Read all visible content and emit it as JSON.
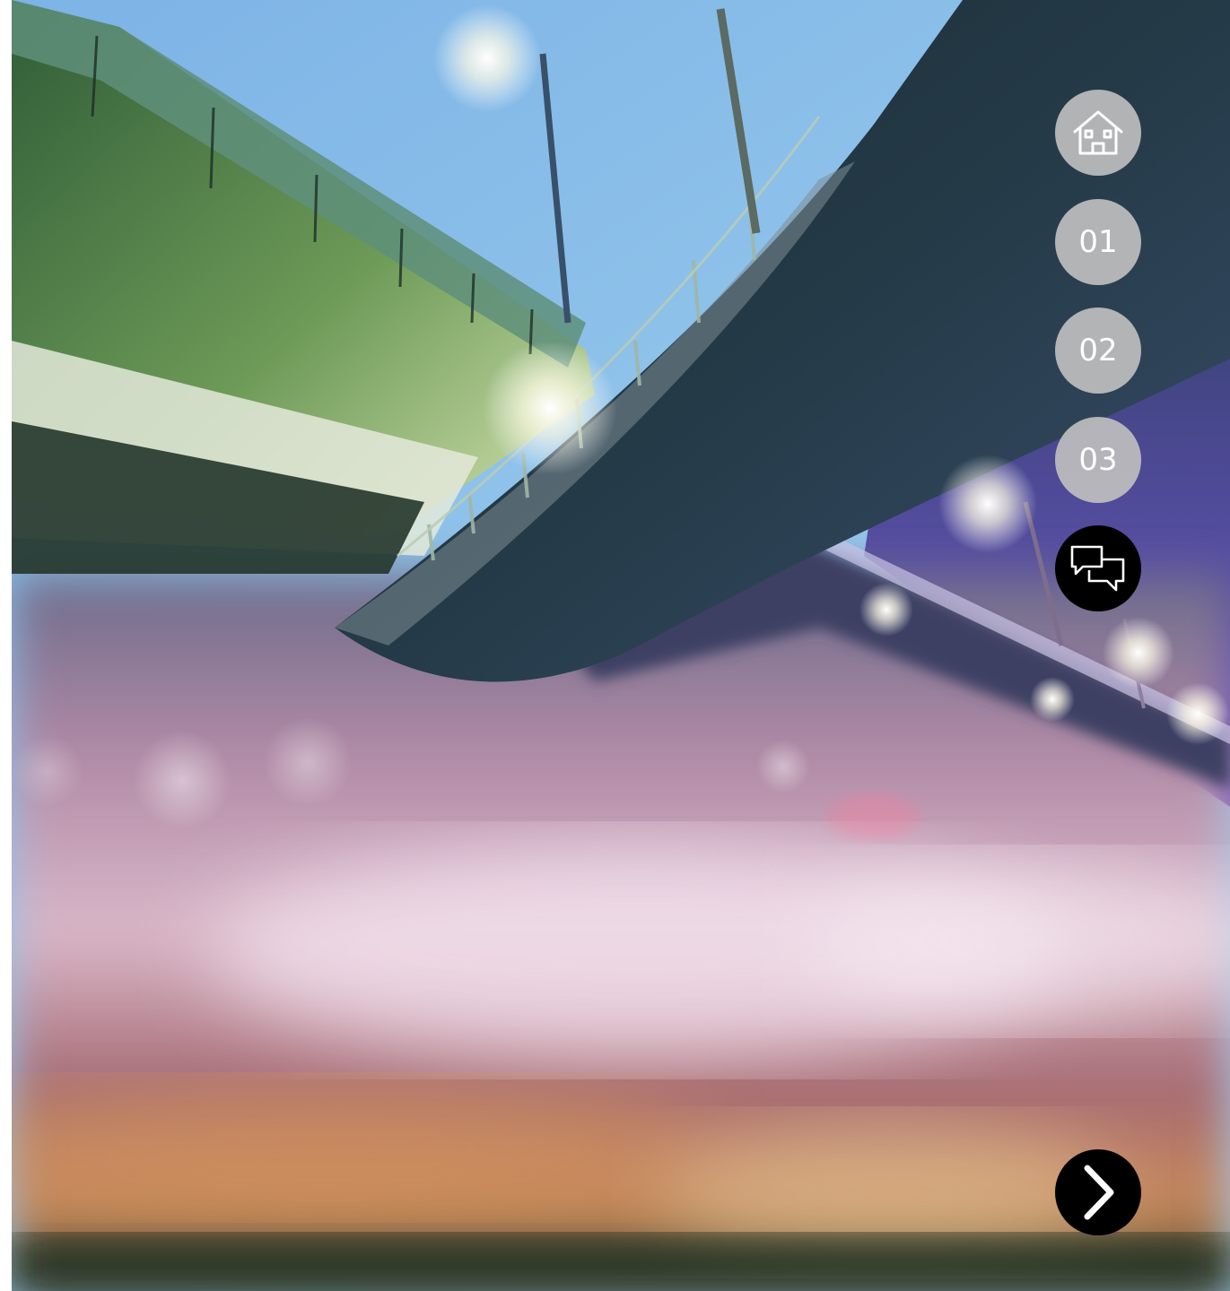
{
  "hero": {
    "image_subject": "night-overpass-photo"
  },
  "nav": {
    "items": [
      {
        "icon": "home-icon",
        "label": ""
      },
      {
        "icon": "",
        "label": "01"
      },
      {
        "icon": "",
        "label": "02"
      },
      {
        "icon": "",
        "label": "03"
      },
      {
        "icon": "chat-bubbles-icon",
        "label": ""
      }
    ],
    "active_index": 4
  },
  "next": {
    "icon": "chevron-right-icon"
  },
  "colors": {
    "nav_inactive": "#bebebe",
    "nav_active": "#000000",
    "icon": "#ffffff"
  }
}
